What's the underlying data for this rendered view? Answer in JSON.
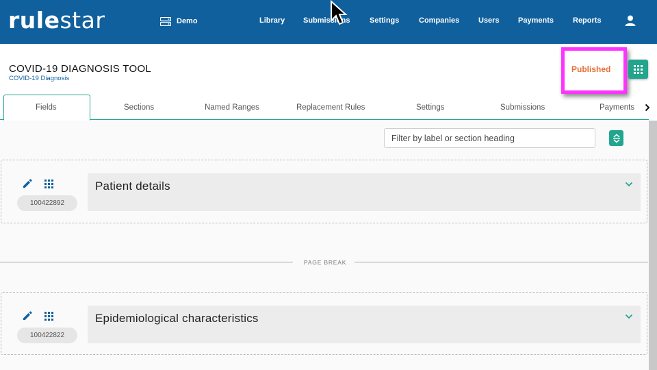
{
  "app": {
    "logo_bold": "rule",
    "logo_light": "star",
    "environment": "Demo",
    "nav": [
      "Library",
      "Submissions",
      "Settings",
      "Companies",
      "Users",
      "Payments",
      "Reports"
    ]
  },
  "header": {
    "title": "COVID-19 DIAGNOSIS TOOL",
    "subtitle": "COVID-19 Diagnosis",
    "status": "Published",
    "status_color": "#e8703a"
  },
  "tabs": [
    "Fields",
    "Sections",
    "Named Ranges",
    "Replacement Rules",
    "Settings",
    "Submissions",
    "Payments"
  ],
  "active_tab": "Fields",
  "filter": {
    "placeholder": "Filter by label or section heading"
  },
  "sections": [
    {
      "id": "100422892",
      "title": "Patient details"
    },
    {
      "id": "100422822",
      "title": "Epidemiological characteristics"
    }
  ],
  "page_break_label": "PAGE BREAK",
  "icons": {
    "environment": "server-icon",
    "user": "user-icon",
    "grid": "grid-icon",
    "collapse": "expand-collapse-icon",
    "edit": "pencil-icon",
    "drag": "drag-handle-icon",
    "expand": "chevron-down-icon",
    "next": "chevron-right-icon"
  },
  "colors": {
    "nav_bg": "#10609e",
    "accent": "#22a58e",
    "highlight": "#ff33ff"
  }
}
